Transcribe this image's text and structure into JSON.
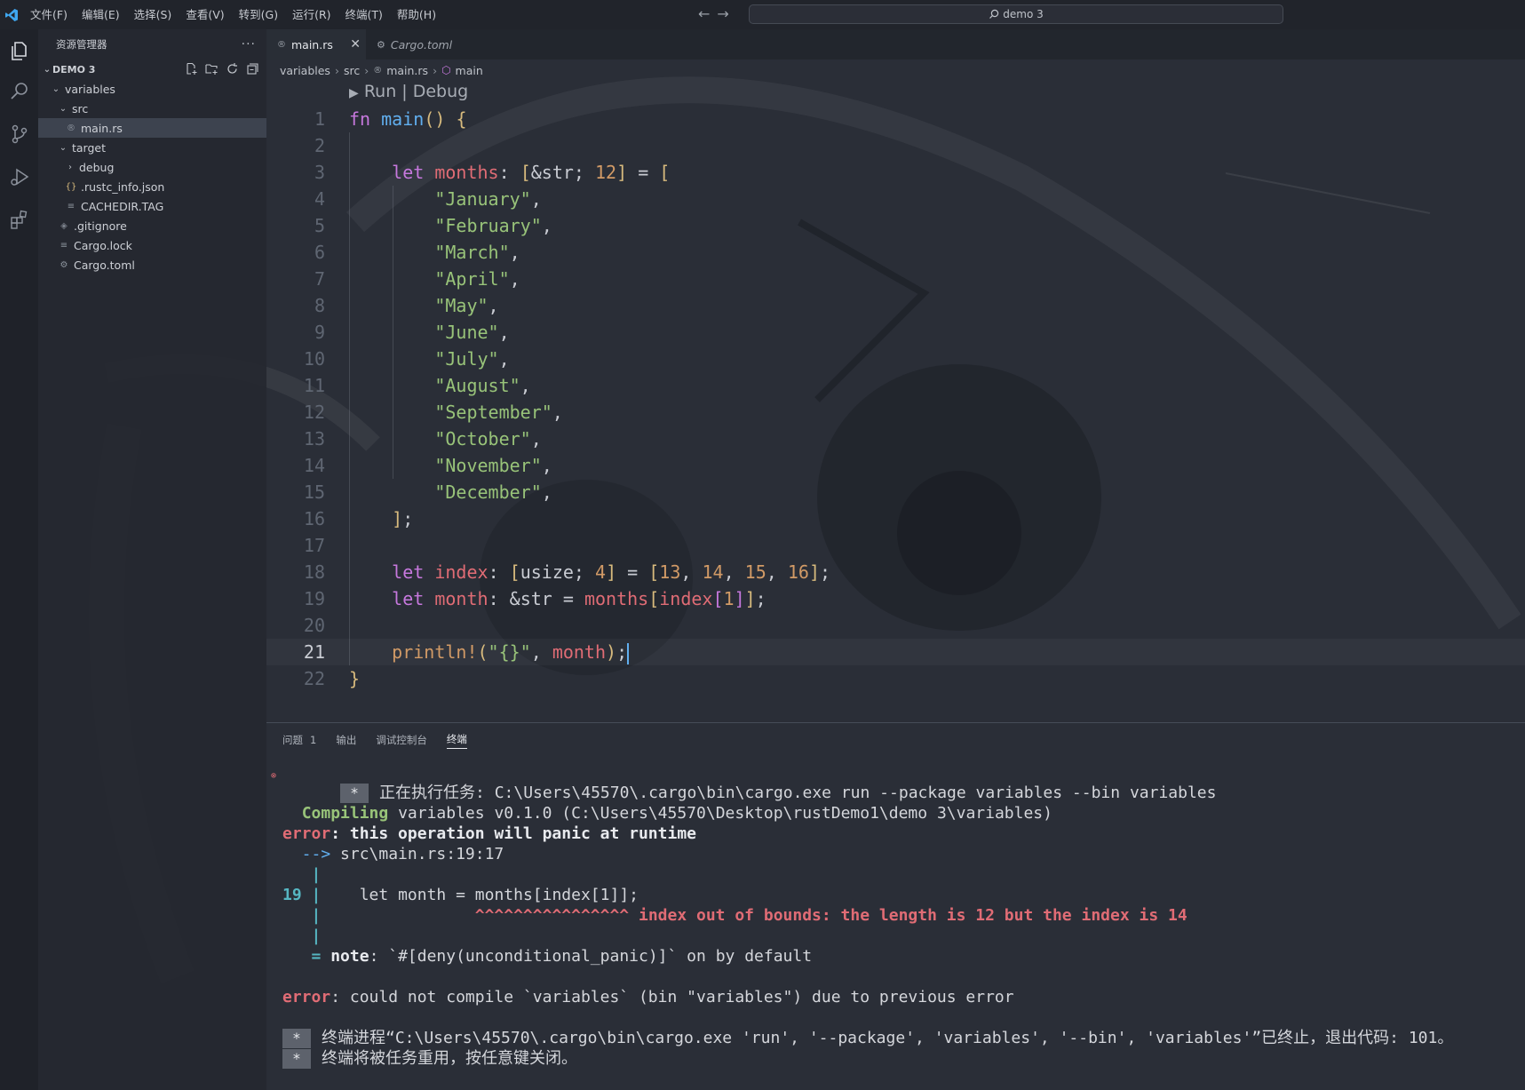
{
  "menu": [
    "文件(F)",
    "编辑(E)",
    "选择(S)",
    "查看(V)",
    "转到(G)",
    "运行(R)",
    "终端(T)",
    "帮助(H)"
  ],
  "command_center": {
    "text": "demo 3"
  },
  "sidebar": {
    "title": "资源管理器",
    "project": "DEMO 3",
    "items": [
      {
        "label": "variables",
        "kind": "folder-open"
      },
      {
        "label": "src",
        "kind": "folder-open"
      },
      {
        "label": "main.rs",
        "kind": "rust-file"
      },
      {
        "label": "target",
        "kind": "folder-open"
      },
      {
        "label": "debug",
        "kind": "folder-closed"
      },
      {
        "label": ".rustc_info.json",
        "kind": "json-file"
      },
      {
        "label": "CACHEDIR.TAG",
        "kind": "text-file"
      },
      {
        "label": ".gitignore",
        "kind": "git-file"
      },
      {
        "label": "Cargo.lock",
        "kind": "text-file"
      },
      {
        "label": "Cargo.toml",
        "kind": "gear-file"
      }
    ]
  },
  "tabs": [
    {
      "label": "main.rs",
      "active": true
    },
    {
      "label": "Cargo.toml",
      "active": false
    }
  ],
  "breadcrumbs": [
    "variables",
    "src",
    "main.rs",
    "main"
  ],
  "codelens": "Run | Debug",
  "editor": {
    "current_line": 21,
    "lines": [
      "fn main() {",
      "",
      "    let months: [&str; 12] = [",
      "        \"January\",",
      "        \"February\",",
      "        \"March\",",
      "        \"April\",",
      "        \"May\",",
      "        \"June\",",
      "        \"July\",",
      "        \"August\",",
      "        \"September\",",
      "        \"October\",",
      "        \"November\",",
      "        \"December\",",
      "    ];",
      "",
      "    let index: [usize; 4] = [13, 14, 15, 16];",
      "    let month: &str = months[index[1]];",
      "",
      "    println!(\"{}\", month);",
      "}"
    ]
  },
  "panel": {
    "tabs": [
      "问题",
      "输出",
      "调试控制台",
      "终端"
    ],
    "problems_count": "1",
    "active_tab": "终端"
  },
  "terminal": {
    "task_box": "*",
    "task_line": "正在执行任务: C:\\Users\\45570\\.cargo\\bin\\cargo.exe run --package variables --bin variables",
    "compiling_label": "Compiling",
    "compiling_text": " variables v0.1.0 (C:\\Users\\45570\\Desktop\\rustDemo1\\demo 3\\variables)",
    "error_label": "error",
    "error1_msg": ": this operation will panic at runtime",
    "arrow": "  -->",
    "location": " src\\main.rs:19:17",
    "pipe": "|",
    "line_no": "19",
    "code_line": "    let month = months[index[1]];",
    "carets": "^^^^^^^^^^^^^^^^",
    "caret_msg": " index out of bounds: the length is 12 but the index is 14",
    "note_eq": "=",
    "note_label": "note",
    "note_msg": ": `#[deny(unconditional_panic)]` on by default",
    "error2_msg": ": could not compile `variables` (bin \"variables\") due to previous error",
    "end_box": "*",
    "end_line1": "终端进程“C:\\Users\\45570\\.cargo\\bin\\cargo.exe 'run', '--package', 'variables', '--bin', 'variables'”已终止，退出代码: 101。",
    "end_line2": "终端将被任务重用，按任意键关闭。"
  },
  "colors": {
    "keyword": "#c678dd",
    "function": "#61afef",
    "variable": "#e06c75",
    "string": "#98c379",
    "number": "#d19a66",
    "terminal_green": "#98c379",
    "terminal_red": "#e06c75",
    "terminal_cyan": "#56b6c2"
  }
}
